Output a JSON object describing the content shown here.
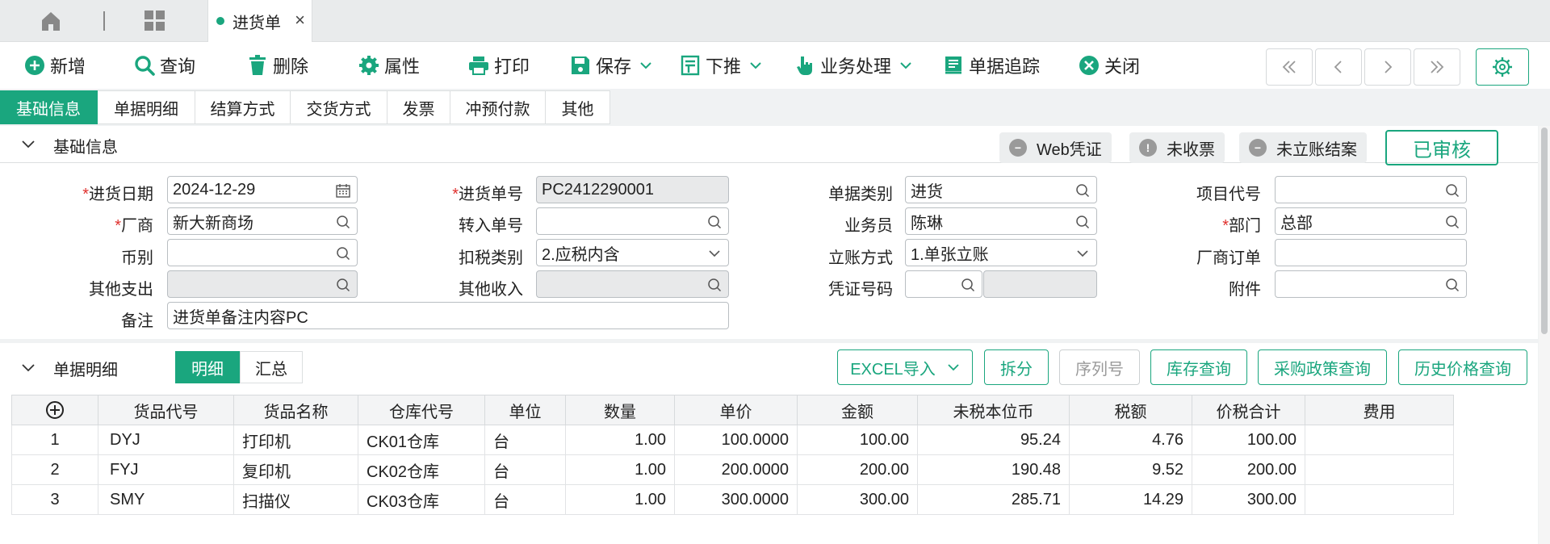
{
  "tab": {
    "label": "进货单",
    "close": "×"
  },
  "toolbar": {
    "new": "新增",
    "query": "查询",
    "delete": "删除",
    "props": "属性",
    "print": "打印",
    "save": "保存",
    "push": "下推",
    "business": "业务处理",
    "trace": "单据追踪",
    "close": "关闭"
  },
  "subtabs": [
    "基础信息",
    "单据明细",
    "结算方式",
    "交货方式",
    "发票",
    "冲预付款",
    "其他"
  ],
  "section1": {
    "title": "基础信息",
    "statuses": {
      "web": "Web凭证",
      "invoice": "未收票",
      "settle": "未立账结案"
    },
    "approved": "已审核"
  },
  "form": {
    "date_label": "进货日期",
    "date_value": "2024-12-29",
    "vendor_label": "厂商",
    "vendor_value": "新大新商场",
    "currency_label": "币别",
    "currency_value": "",
    "other_exp_label": "其他支出",
    "other_exp_value": "",
    "remark_label": "备注",
    "remark_value": "进货单备注内容PC",
    "no_label": "进货单号",
    "no_value": "PC2412290001",
    "transfer_label": "转入单号",
    "transfer_value": "",
    "tax_label": "扣税类别",
    "tax_value": "2.应税内含",
    "other_inc_label": "其他收入",
    "other_inc_value": "",
    "doctype_label": "单据类别",
    "doctype_value": "进货",
    "clerk_label": "业务员",
    "clerk_value": "陈琳",
    "account_label": "立账方式",
    "account_value": "1.单张立账",
    "voucher_label": "凭证号码",
    "voucher_value": "",
    "project_label": "项目代号",
    "project_value": "",
    "dept_label": "部门",
    "dept_value": "总部",
    "vendor_order_label": "厂商订单",
    "vendor_order_value": "",
    "attach_label": "附件",
    "attach_value": ""
  },
  "section2": {
    "title": "单据明细",
    "seg_detail": "明细",
    "seg_summary": "汇总",
    "btn_excel": "EXCEL导入",
    "btn_split": "拆分",
    "btn_serial": "序列号",
    "btn_stock": "库存查询",
    "btn_policy": "采购政策查询",
    "btn_history": "历史价格查询"
  },
  "table": {
    "headers": [
      "货品代号",
      "货品名称",
      "仓库代号",
      "单位",
      "数量",
      "单价",
      "金额",
      "未税本位币",
      "税额",
      "价税合计",
      "费用"
    ],
    "rows": [
      [
        "1",
        "DYJ",
        "打印机",
        "CK01仓库",
        "台",
        "1.00",
        "100.0000",
        "100.00",
        "95.24",
        "4.76",
        "100.00",
        ""
      ],
      [
        "2",
        "FYJ",
        "复印机",
        "CK02仓库",
        "台",
        "1.00",
        "200.0000",
        "200.00",
        "190.48",
        "9.52",
        "200.00",
        ""
      ],
      [
        "3",
        "SMY",
        "扫描仪",
        "CK03仓库",
        "台",
        "1.00",
        "300.0000",
        "300.00",
        "285.71",
        "14.29",
        "300.00",
        ""
      ]
    ]
  },
  "colors": {
    "accent": "#1aa67e",
    "required": "#e0312e"
  },
  "icons": [
    "home-icon",
    "grid-icon",
    "plus-circle-icon",
    "search-icon",
    "trash-icon",
    "gear-icon",
    "printer-icon",
    "save-icon",
    "push-icon",
    "hand-pointer-icon",
    "receipt-icon",
    "close-circle-icon",
    "chevron-down-icon",
    "calendar-icon"
  ]
}
